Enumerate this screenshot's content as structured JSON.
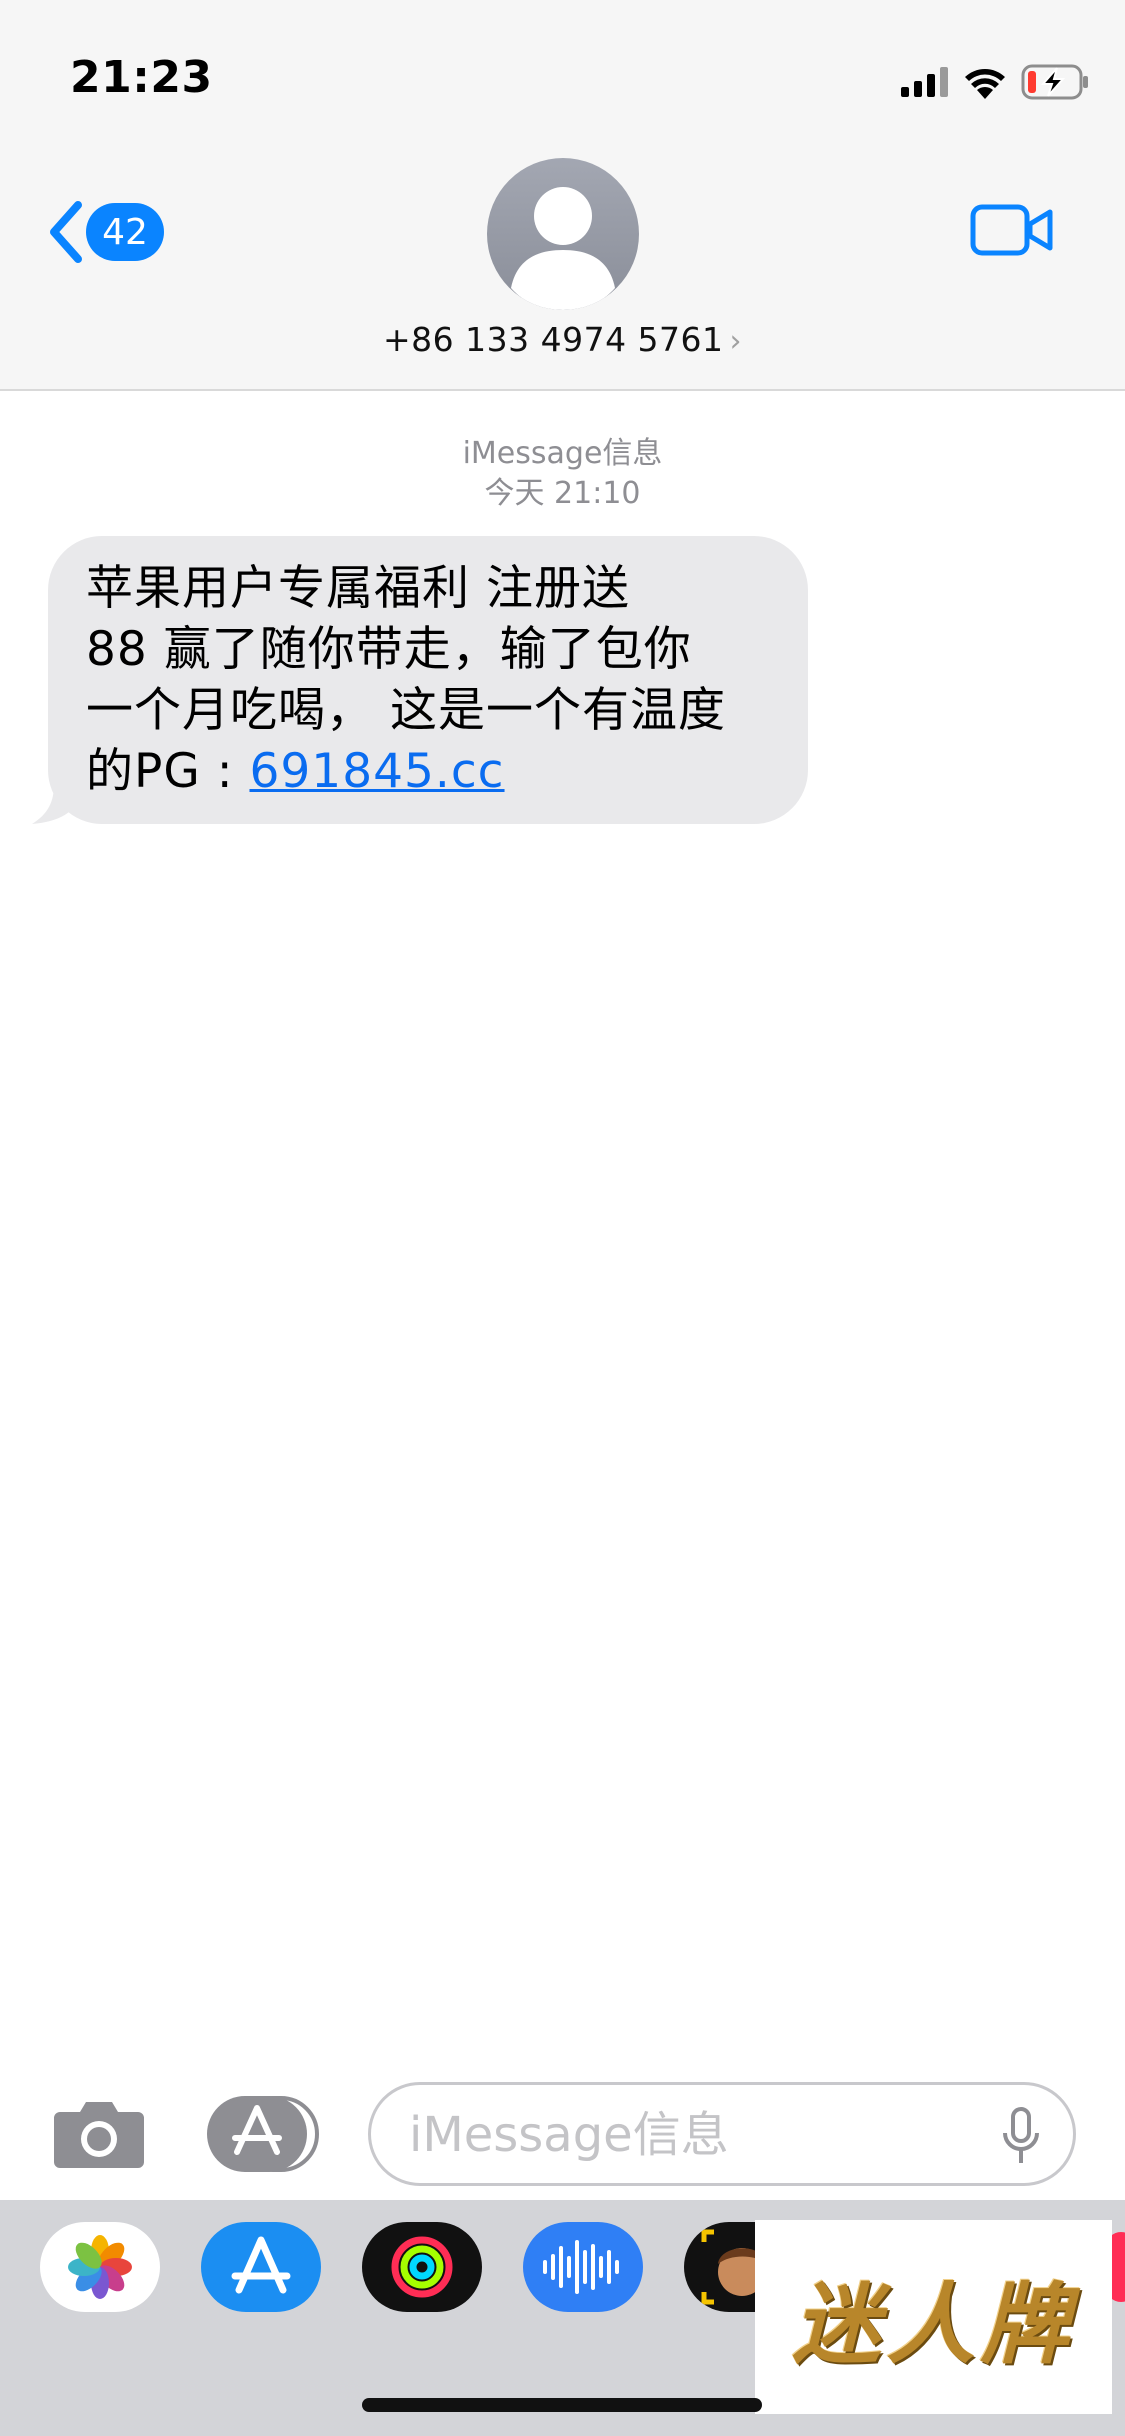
{
  "status_bar": {
    "time": "21:23",
    "battery_state": "low, charging"
  },
  "header": {
    "back_badge_count": "42",
    "contact_name": "+86 133 4974 5761",
    "contact_chevron": "›"
  },
  "conversation": {
    "service_label": "iMessage信息",
    "timestamp": "今天 21:10",
    "message": {
      "lines": [
        "苹果用户专属福利 注册送",
        "88  赢了随你带走，输了包你",
        "一个月吃喝， 这是一个有温度",
        "的PG : "
      ],
      "link": "691845.cc"
    }
  },
  "composer": {
    "placeholder": "iMessage信息"
  },
  "app_drawer": {
    "apps": [
      "photos-app",
      "app-store-app",
      "activity-app",
      "voice-memo-app",
      "memoji-app"
    ]
  },
  "watermark": {
    "text": "迷人牌"
  },
  "colors": {
    "accent": "#0a84ff",
    "bubble": "#e9e9eb",
    "link": "#0a6cf0",
    "header_bg": "#f6f6f6"
  }
}
